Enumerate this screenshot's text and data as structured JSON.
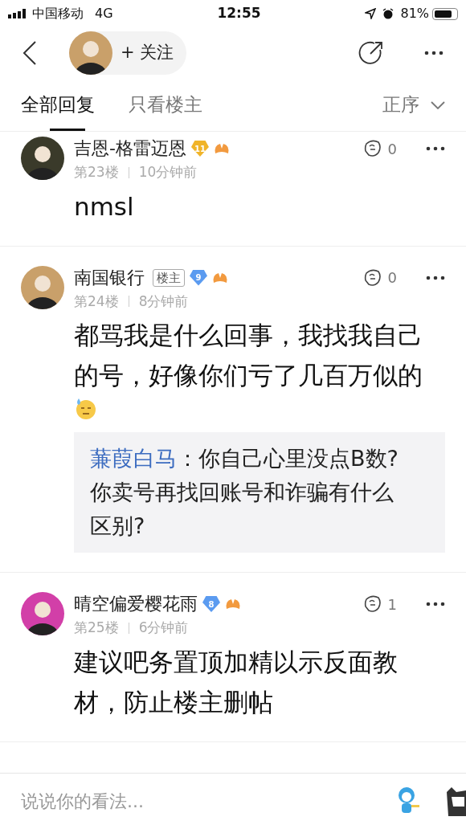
{
  "status_bar": {
    "carrier": "中国移动",
    "network": "4G",
    "time": "12:55",
    "battery": "81%"
  },
  "nav": {
    "follow": "+ 关注"
  },
  "tabs": [
    {
      "label": "全部回复",
      "selected": true
    },
    {
      "label": "只看楼主",
      "selected": false
    }
  ],
  "sort": "正序",
  "posts": [
    {
      "author": "吉恩-格雷迈恩",
      "level": "11",
      "color": "#f0b429",
      "floor": "第23楼",
      "time": "10分钟前",
      "likes": "0",
      "text": "nmsl",
      "emoji": false
    },
    {
      "author": "南国银行",
      "owner_tag": "楼主",
      "level": "9",
      "color": "#5b9bf0",
      "floor": "第24楼",
      "time": "8分钟前",
      "likes": "0",
      "text": "都骂我是什么回事，我找我自己的号，好像你们亏了几百万似的",
      "emoji": true,
      "reply": {
        "author": "蒹葭白马",
        "text": "：你自己心里没点B数?你卖号再找回账号和诈骗有什么区别?"
      }
    },
    {
      "author": "晴空偏爱樱花雨",
      "level": "8",
      "color": "#5b9bf0",
      "floor": "第25楼",
      "time": "6分钟前",
      "likes": "1",
      "text": "建议吧务置顶加精以示反面教材，防止楼主删帖",
      "emoji": false
    }
  ],
  "comment_box": {
    "placeholder": "说说你的看法..."
  }
}
